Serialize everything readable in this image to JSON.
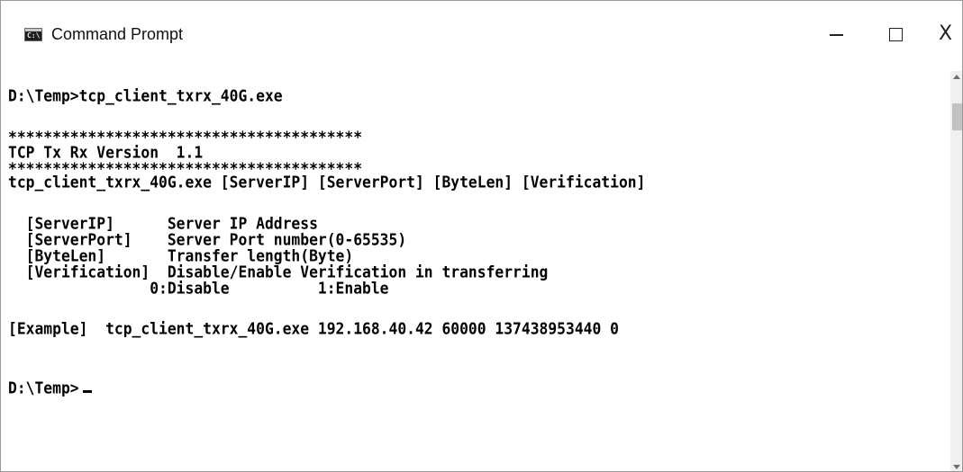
{
  "window": {
    "title": "Command Prompt",
    "icon": "cmd-icon",
    "icon_text": "C:\\",
    "controls": {
      "minimize": "minimize-icon",
      "maximize": "maximize-icon",
      "close_glyph": "X"
    }
  },
  "console": {
    "lines": [
      "D:\\Temp>tcp_client_txrx_40G.exe",
      "****************************************",
      "TCP Tx Rx Version  1.1",
      "****************************************",
      "tcp_client_txrx_40G.exe [ServerIP] [ServerPort] [ByteLen] [Verification]",
      "  [ServerIP]      Server IP Address",
      "  [ServerPort]    Server Port number(0-65535)",
      "  [ByteLen]       Transfer length(Byte)",
      "  [Verification]  Disable/Enable Verification in transferring",
      "                0:Disable          1:Enable",
      "[Example]  tcp_client_txrx_40G.exe 192.168.40.42 60000 137438953440 0",
      "D:\\Temp>"
    ]
  },
  "colors": {
    "console_background": "#ffffff",
    "console_text": "#000000",
    "titlebar_background": "#ffffff"
  }
}
